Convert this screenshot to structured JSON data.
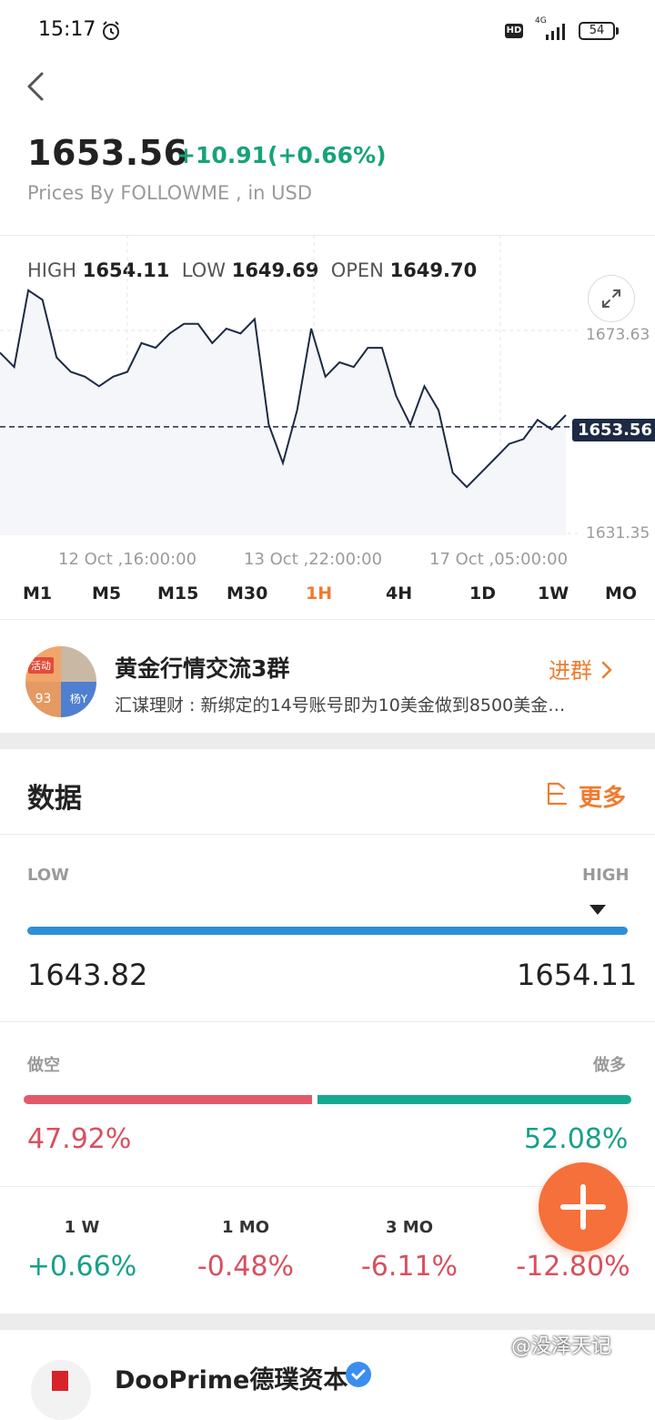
{
  "status_bar": {
    "time": "15:17",
    "hd": "HD",
    "network": "4G",
    "battery": "54"
  },
  "header": {
    "price": "1653.56",
    "change": "+10.91(+0.66%)",
    "source": "Prices By FOLLOWME , in USD"
  },
  "stats": {
    "high_label": "HIGH",
    "high": "1654.11",
    "low_label": "LOW",
    "low": "1649.69",
    "open_label": "OPEN",
    "open": "1649.70"
  },
  "chart_data": {
    "type": "line",
    "y_ticks": [
      "1673.63",
      "1631.35"
    ],
    "ylim": [
      1631.35,
      1673.63
    ],
    "current_price_label": "1653.56",
    "current_price": 1653.56,
    "x_ticks": [
      "12 Oct ,16:00:00",
      "13 Oct ,22:00:00",
      "17 Oct ,05:00:00"
    ],
    "series": [
      {
        "values": [
          1669,
          1666,
          1682,
          1680,
          1668,
          1665,
          1664,
          1662,
          1664,
          1665,
          1671,
          1670,
          1673,
          1675,
          1675,
          1671,
          1674,
          1673,
          1676,
          1654,
          1646,
          1657,
          1674,
          1664,
          1667,
          1666,
          1670,
          1670,
          1660,
          1654,
          1662,
          1657,
          1644,
          1641,
          1644,
          1647,
          1650,
          1651,
          1655,
          1653,
          1656
        ]
      }
    ]
  },
  "timeframes": [
    "M1",
    "M5",
    "M15",
    "M30",
    "1H",
    "4H",
    "1D",
    "1W",
    "MO"
  ],
  "active_timeframe": "1H",
  "group": {
    "name": "黄金行情交流3群",
    "message": "汇谋理财 : 新绑定的14号账号即为10美金做到8500美金…",
    "join_label": "进群",
    "avatar_tag": "活动",
    "avatar_text_a": "93",
    "avatar_text_b": "杨Y"
  },
  "data_section": {
    "title": "数据",
    "more_label": "更多",
    "low_label": "LOW",
    "high_label": "HIGH",
    "range_low": "1643.82",
    "range_high": "1654.11",
    "range_position": 1.0,
    "short_label": "做空",
    "long_label": "做多",
    "short_pct": "47.92%",
    "long_pct": "52.08%",
    "short_fraction": 0.4792
  },
  "performance": [
    {
      "label": "1 W",
      "value": "+0.66%",
      "color": "#17a08a"
    },
    {
      "label": "1 MO",
      "value": "-0.48%",
      "color": "#d9505f"
    },
    {
      "label": "3 MO",
      "value": "-6.11%",
      "color": "#d9505f"
    },
    {
      "label": "",
      "value": "-12.80%",
      "color": "#d9505f"
    }
  ],
  "broker": {
    "name": "DooPrime德璞资本"
  },
  "watermark": "@没泽天记"
}
